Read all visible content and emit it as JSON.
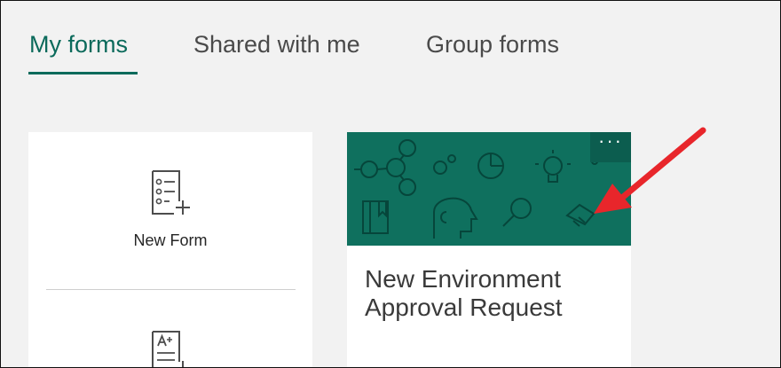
{
  "tabs": [
    {
      "label": "My forms",
      "active": true
    },
    {
      "label": "Shared with me",
      "active": false
    },
    {
      "label": "Group forms",
      "active": false
    }
  ],
  "new_tile": {
    "new_form_label": "New Form"
  },
  "form_card": {
    "title": "New Environment Approval Request",
    "more_label": "···"
  },
  "colors": {
    "accent": "#0b6a5b",
    "banner": "#0f705e",
    "annotation_arrow": "#e8262b"
  },
  "icons": [
    "new-form-icon",
    "new-quiz-icon",
    "more-options-icon",
    "annotation-arrow"
  ]
}
